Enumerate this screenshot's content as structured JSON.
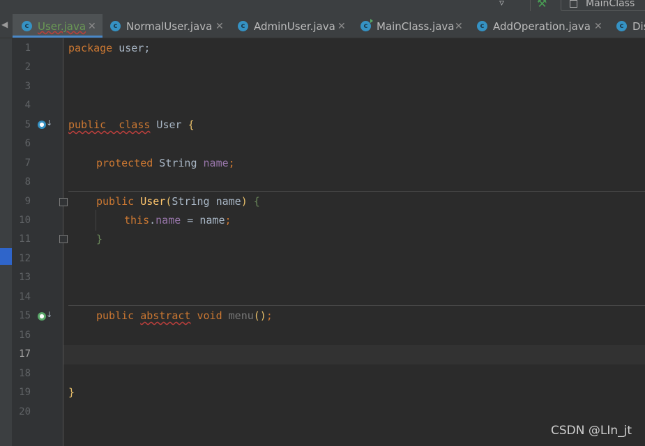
{
  "toolbar": {
    "run_config": "MainClass"
  },
  "tabs": [
    {
      "label": "User.java",
      "active": true
    },
    {
      "label": "NormalUser.java"
    },
    {
      "label": "AdminUser.java"
    },
    {
      "label": "MainClass.java"
    },
    {
      "label": "AddOperation.java"
    },
    {
      "label": "Dis"
    }
  ],
  "tab_icon_letter": "c",
  "line_numbers": [
    "1",
    "2",
    "3",
    "4",
    "5",
    "6",
    "7",
    "8",
    "9",
    "10",
    "11",
    "12",
    "13",
    "14",
    "15",
    "16",
    "17",
    "18",
    "19",
    "20"
  ],
  "current_line": "17",
  "code": {
    "l1_kw": "package",
    "l1_rest": " user;",
    "l5_public": "public",
    "l5_class": "  class",
    "l5_name": " User ",
    "l5_brace": "{",
    "l7_kw": "protected",
    "l7_type": " String ",
    "l7_field": "name",
    "l7_end": ";",
    "l9_kw": "public",
    "l9_method": " User",
    "l9_paren_open": "(",
    "l9_params": "String name",
    "l9_paren_close": ")",
    "l9_brace": " {",
    "l10_this": "this",
    "l10_dot": ".",
    "l10_field": "name",
    "l10_rest": " = name",
    "l10_end": ";",
    "l11_brace": "}",
    "l15_kw": "public",
    "l15_abstract": "abstract",
    "l15_void": " void ",
    "l15_method": "menu",
    "l15_parens": "()",
    "l15_end": ";",
    "l19_brace": "}"
  },
  "watermark": "CSDN @LIn_jt",
  "colors": {
    "keyword": "#cc7832",
    "field": "#9876aa",
    "method": "#ffc66d",
    "background": "#2b2b2b",
    "tab_accent": "#4a88c7"
  }
}
